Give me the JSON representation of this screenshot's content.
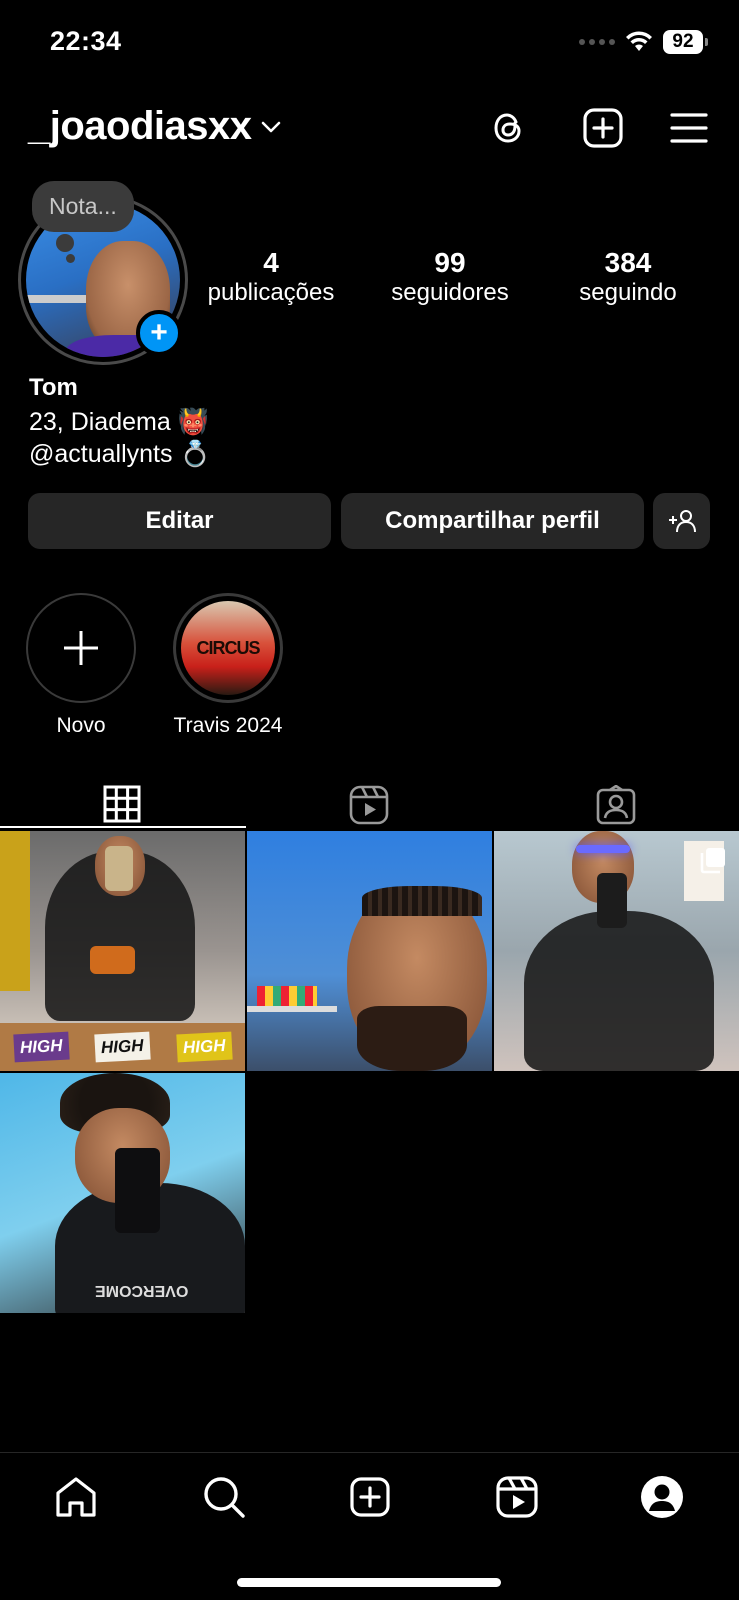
{
  "status_bar": {
    "time": "22:34",
    "battery": "92"
  },
  "header": {
    "username": "_joaodiasxx"
  },
  "profile": {
    "note": "Nota...",
    "stats": [
      {
        "value": "4",
        "label": "publicações"
      },
      {
        "value": "99",
        "label": "seguidores"
      },
      {
        "value": "384",
        "label": "seguindo"
      }
    ],
    "name": "Tom",
    "bio_lines": [
      "23, Diadema 👹",
      "@actuallynts 💍"
    ]
  },
  "actions": {
    "edit": "Editar",
    "share": "Compartilhar perfil"
  },
  "highlights": [
    {
      "label": "Novo"
    },
    {
      "label": "Travis 2024"
    }
  ],
  "highlight_art_text": "CIRCUS",
  "grid_overlay_text": {
    "high": "HIGH",
    "overcome": "OVERCOME"
  },
  "colors": {
    "accent": "#0095f6",
    "button_bg": "#262626",
    "background": "#000000"
  }
}
